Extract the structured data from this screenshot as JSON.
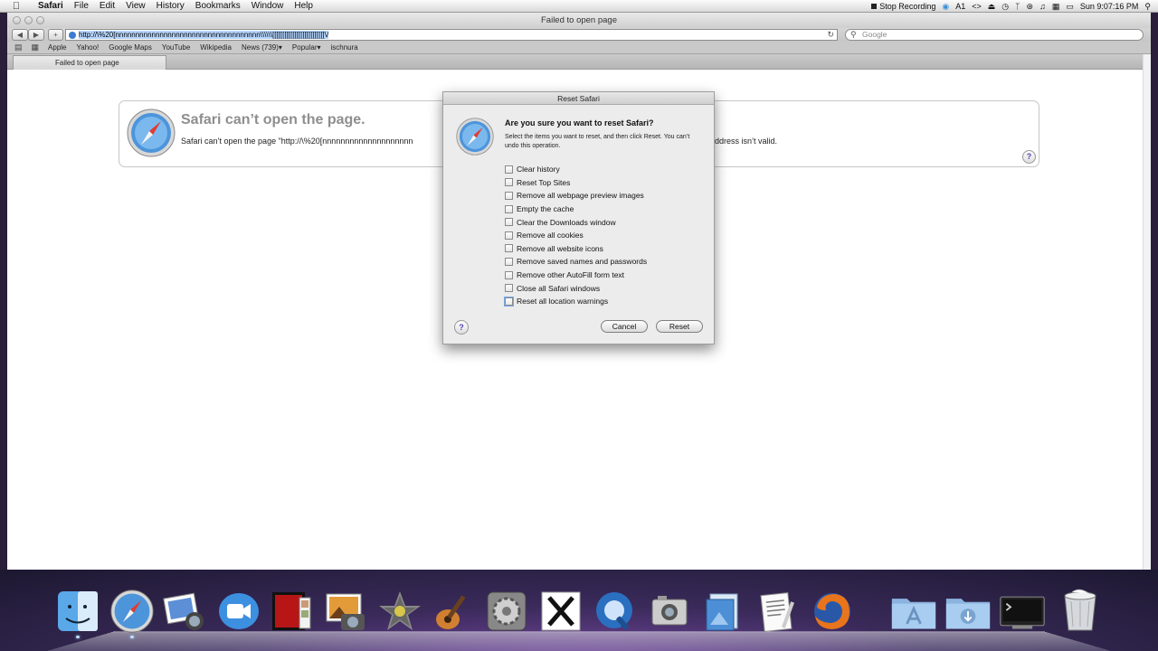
{
  "menubar": {
    "app": "Safari",
    "items": [
      "File",
      "Edit",
      "View",
      "History",
      "Bookmarks",
      "Window",
      "Help"
    ],
    "stop_recording": "Stop Recording",
    "display_num": "1",
    "clock": "Sun 9:07:16 PM"
  },
  "window": {
    "title": "Failed to open page",
    "url": "http://\\%20[nnnnnnnnnnnnnnnnnnnnnnnnnnnnnnnnnnnn\\\\\\\\\\\\[[[[[[[[[[[[[[[[[[[[[[[[[[\\/",
    "search_placeholder": "Google",
    "bookmarks": [
      "Apple",
      "Yahoo!",
      "Google Maps",
      "YouTube",
      "Wikipedia",
      "News (739)▾",
      "Popular▾",
      "ischnura"
    ],
    "tab_label": "Failed to open page"
  },
  "error": {
    "title": "Safari can’t open the page.",
    "message": "Safari can’t open the page \"http://\\%20[nnnnnnnnnnnnnnnnnnnn",
    "message_tail": "ddress isn’t valid."
  },
  "sheet": {
    "title": "Reset Safari",
    "question": "Are you sure you want to reset Safari?",
    "description": "Select the items you want to reset, and then click Reset. You can’t undo this operation.",
    "options": [
      "Clear history",
      "Reset Top Sites",
      "Remove all webpage preview images",
      "Empty the cache",
      "Clear the Downloads window",
      "Remove all cookies",
      "Remove all website icons",
      "Remove saved names and passwords",
      "Remove other AutoFill form text",
      "Close all Safari windows",
      "Reset all location warnings"
    ],
    "cancel_label": "Cancel",
    "reset_label": "Reset",
    "help_label": "?"
  },
  "dock": {
    "icons": [
      "finder-icon",
      "safari-icon",
      "iphoto-icon",
      "facetime-icon",
      "photo-booth-icon",
      "iphoto-library-icon",
      "imovie-icon",
      "garageband-icon",
      "system-preferences-icon",
      "x11-icon",
      "quicktime-icon",
      "image-capture-icon",
      "preview-icon",
      "textedit-icon",
      "firefox-icon",
      "applications-folder-icon",
      "downloads-folder-icon",
      "terminal-icon",
      "trash-icon"
    ]
  }
}
